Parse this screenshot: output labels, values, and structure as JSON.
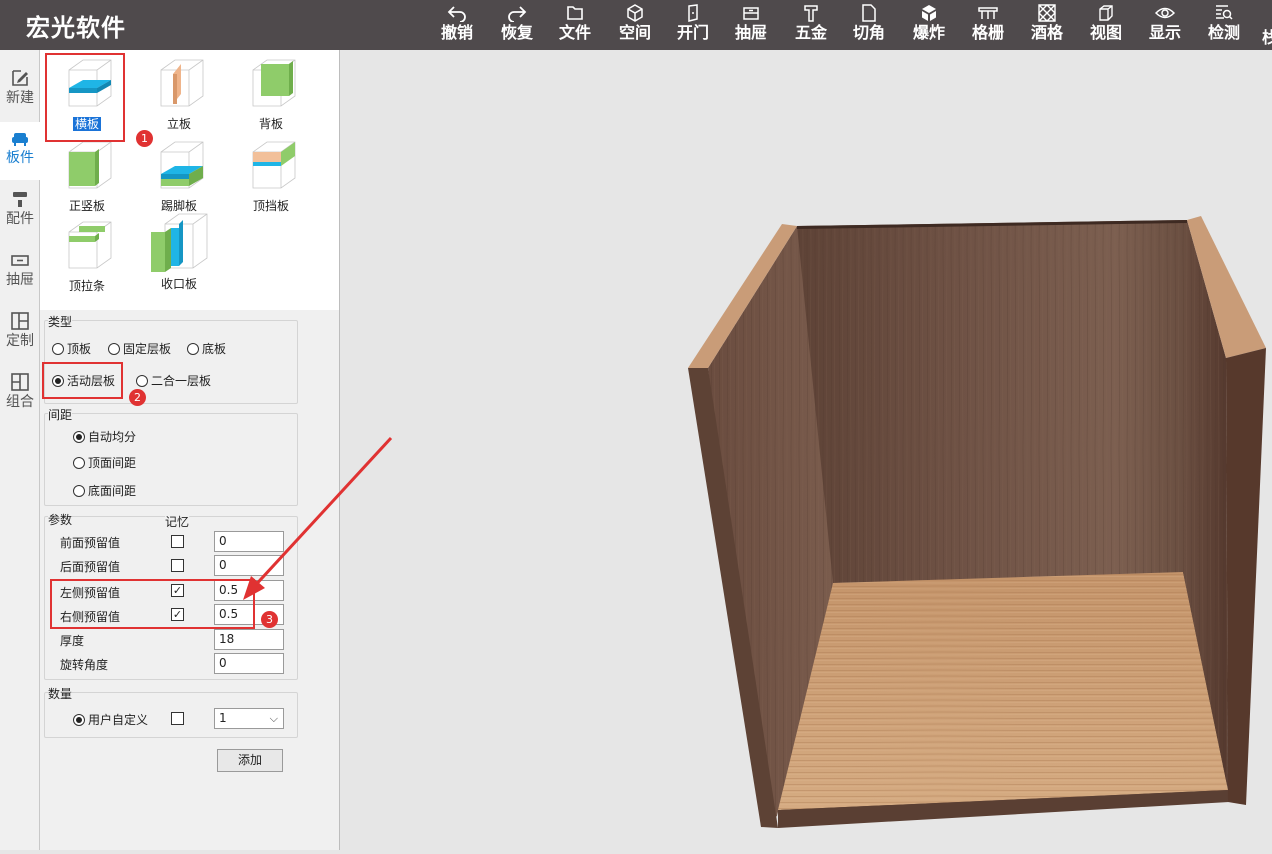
{
  "app": {
    "title": "宏光软件"
  },
  "toolbar": [
    {
      "label": "撤销",
      "icon": "undo-icon"
    },
    {
      "label": "恢复",
      "icon": "redo-icon"
    },
    {
      "label": "文件",
      "icon": "folder-icon"
    },
    {
      "label": "空间",
      "icon": "cube-outline-icon"
    },
    {
      "label": "开门",
      "icon": "door-icon"
    },
    {
      "label": "抽屉",
      "icon": "drawer-icon"
    },
    {
      "label": "五金",
      "icon": "hardware-icon"
    },
    {
      "label": "切角",
      "icon": "corner-cut-icon"
    },
    {
      "label": "爆炸",
      "icon": "explode-icon"
    },
    {
      "label": "格栅",
      "icon": "grille-icon"
    },
    {
      "label": "酒格",
      "icon": "wine-rack-icon"
    },
    {
      "label": "视图",
      "icon": "view-icon"
    },
    {
      "label": "显示",
      "icon": "eye-icon"
    },
    {
      "label": "检测",
      "icon": "inspect-icon"
    }
  ],
  "sidenav": [
    {
      "label": "新建",
      "icon": "edit-icon",
      "active": false
    },
    {
      "label": "板件",
      "icon": "sofa-icon",
      "active": true
    },
    {
      "label": "配件",
      "icon": "roller-icon",
      "active": false
    },
    {
      "label": "抽屉",
      "icon": "drawer-icon",
      "active": false
    },
    {
      "label": "定制",
      "icon": "layout-icon",
      "active": false
    },
    {
      "label": "组合",
      "icon": "combine-icon",
      "active": false
    }
  ],
  "palette": [
    {
      "label": "横板",
      "selected": true
    },
    {
      "label": "立板",
      "selected": false
    },
    {
      "label": "背板",
      "selected": false
    },
    {
      "label": "正竖板",
      "selected": false
    },
    {
      "label": "踢脚板",
      "selected": false
    },
    {
      "label": "顶挡板",
      "selected": false
    },
    {
      "label": "顶拉条",
      "selected": false
    },
    {
      "label": "收口板",
      "selected": false
    }
  ],
  "type_group": {
    "title": "类型",
    "options": [
      {
        "label": "顶板",
        "checked": false
      },
      {
        "label": "固定层板",
        "checked": false
      },
      {
        "label": "底板",
        "checked": false
      },
      {
        "label": "活动层板",
        "checked": true
      },
      {
        "label": "二合一层板",
        "checked": false
      }
    ]
  },
  "spacing_group": {
    "title": "间距",
    "options": [
      {
        "label": "自动均分",
        "checked": true
      },
      {
        "label": "顶面间距",
        "checked": false
      },
      {
        "label": "底面间距",
        "checked": false
      }
    ]
  },
  "params_group": {
    "title": "参数",
    "memory_header": "记忆",
    "rows": [
      {
        "label": "前面预留值",
        "memory": false,
        "value": "0"
      },
      {
        "label": "后面预留值",
        "memory": false,
        "value": "0"
      },
      {
        "label": "左侧预留值",
        "memory": true,
        "value": "0.5"
      },
      {
        "label": "右侧预留值",
        "memory": true,
        "value": "0.5"
      },
      {
        "label": "厚度",
        "memory": null,
        "value": "18"
      },
      {
        "label": "旋转角度",
        "memory": null,
        "value": "0"
      }
    ]
  },
  "quantity_group": {
    "title": "数量",
    "option": {
      "label": "用户自定义",
      "checked": true
    },
    "memory": false,
    "value": "1"
  },
  "add_button": "添加",
  "annotations": [
    "1",
    "2",
    "3"
  ],
  "colors": {
    "topbar": "#4f4a4c",
    "accent": "#1a73d8",
    "annotation": "#e03232",
    "wood_dark": "#6b4a3c",
    "wood_light": "#c79b73"
  }
}
